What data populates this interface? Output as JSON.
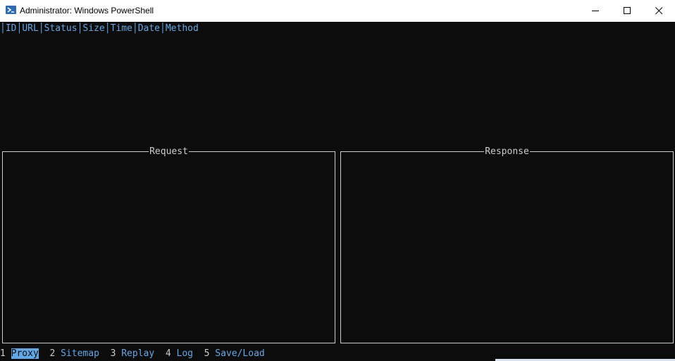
{
  "window": {
    "title": "Administrator: Windows PowerShell",
    "icon": "powershell-icon",
    "buttons": [
      "minimize-icon",
      "maximize-icon",
      "close-icon"
    ]
  },
  "table": {
    "columns": [
      "ID",
      "URL",
      "Status",
      "Size",
      "Time",
      "Date",
      "Method"
    ]
  },
  "panels": {
    "request_title": "Request",
    "response_title": "Response"
  },
  "tabs": [
    {
      "number": "1",
      "label": "Proxy",
      "active": true
    },
    {
      "number": "2",
      "label": "Sitemap",
      "active": false
    },
    {
      "number": "3",
      "label": "Replay",
      "active": false
    },
    {
      "number": "4",
      "label": "Log",
      "active": false
    },
    {
      "number": "5",
      "label": "Save/Load",
      "active": false
    }
  ],
  "colors": {
    "background": "#0c0c0c",
    "foreground": "#cccccc",
    "accent": "#61a8e6"
  }
}
